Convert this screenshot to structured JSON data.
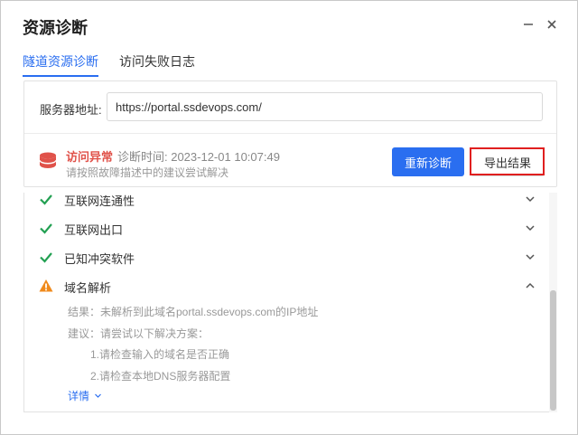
{
  "dialog": {
    "title": "资源诊断"
  },
  "tabs": [
    {
      "label": "隧道资源诊断",
      "active": true
    },
    {
      "label": "访问失败日志",
      "active": false
    }
  ],
  "server": {
    "label": "服务器地址:",
    "value": "https://portal.ssdevops.com/"
  },
  "status": {
    "label": "访问异常",
    "time": "诊断时间: 2023-12-01 10:07:49",
    "hint": "请按照故障描述中的建议尝试解决",
    "icon": "database-error-icon",
    "color": "#e0524a"
  },
  "buttons": {
    "rediagnose": "重新诊断",
    "export": "导出结果"
  },
  "checks": [
    {
      "label": "互联网连通性",
      "status": "ok",
      "icon": "check-icon",
      "expanded": false
    },
    {
      "label": "互联网出口",
      "status": "ok",
      "icon": "check-icon",
      "expanded": false
    },
    {
      "label": "已知冲突软件",
      "status": "ok",
      "icon": "check-icon",
      "expanded": false
    },
    {
      "label": "域名解析",
      "status": "warning",
      "icon": "warning-icon",
      "expanded": true
    }
  ],
  "dns_detail": {
    "result": "结果：未解析到此域名portal.ssdevops.com的IP地址",
    "suggestion": "建议：请尝试以下解决方案：",
    "steps": [
      "1.请检查输入的域名是否正确",
      "2.请检查本地DNS服务器配置"
    ],
    "more": "详情"
  },
  "colors": {
    "accent": "#2a6ef0",
    "ok": "#22a052",
    "warning": "#f08a1c",
    "error": "#e0524a",
    "highlight": "#e01f1f"
  }
}
